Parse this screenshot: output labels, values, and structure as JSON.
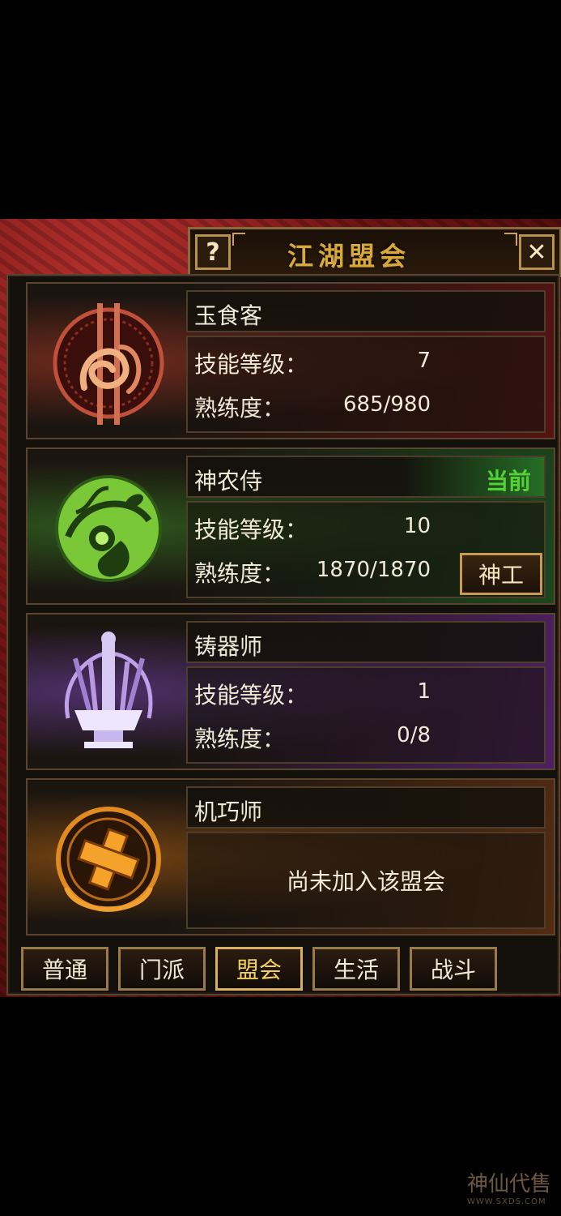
{
  "window": {
    "title": "江湖盟会",
    "help_label": "?",
    "close_label": "✕"
  },
  "guilds": [
    {
      "name": "玉食客",
      "status": "",
      "skill_label": "技能等级：",
      "skill_level": "7",
      "prof_label": "熟练度：",
      "proficiency": "685/980",
      "action": "",
      "theme": "#b3402a",
      "icon": "chef-emblem-icon"
    },
    {
      "name": "神农侍",
      "status": "当前",
      "skill_label": "技能等级：",
      "skill_level": "10",
      "prof_label": "熟练度：",
      "proficiency": "1870/1870",
      "action": "神工",
      "theme": "#3a8a2a",
      "icon": "herb-gourd-emblem-icon"
    },
    {
      "name": "铸器师",
      "status": "",
      "skill_label": "技能等级：",
      "skill_level": "1",
      "prof_label": "熟练度：",
      "proficiency": "0/8",
      "action": "",
      "theme": "#7a3aa8",
      "icon": "forge-anvil-emblem-icon"
    },
    {
      "name": "机巧师",
      "status": "",
      "message": "尚未加入该盟会",
      "theme": "#c07010",
      "icon": "gear-block-emblem-icon"
    }
  ],
  "tabs": [
    {
      "label": "普通"
    },
    {
      "label": "门派"
    },
    {
      "label": "盟会",
      "active": true
    },
    {
      "label": "生活"
    },
    {
      "label": "战斗"
    }
  ],
  "watermark": {
    "text": "神仙代售",
    "url": "WWW.SXDS.COM"
  }
}
